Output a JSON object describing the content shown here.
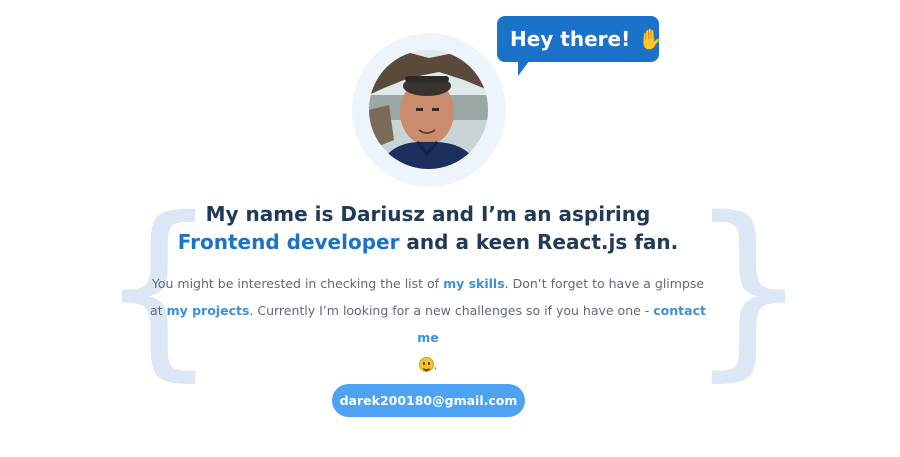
{
  "greeting": {
    "text": "Hey there!",
    "emoji_icon": "waving-hand-icon"
  },
  "profile": {
    "avatar_icon": "profile-photo"
  },
  "intro": {
    "line1": "My name is Dariusz and I’m an aspiring",
    "role": "Frontend developer",
    "line2_rest": " and a keen React.js fan."
  },
  "description": {
    "part1": "You might be interested in checking the list of ",
    "skills_link": "my skills",
    "part2": ". Don’t forget to have a glimpse at ",
    "projects_link": "my projects",
    "part3": ". Currently I’m looking for a new challenges so if you have one - ",
    "contact_link": "contact me",
    "part4": ".",
    "emoji_icon": "smiley-icon"
  },
  "email": {
    "label": "darek200180@gmail.com"
  },
  "decor": {
    "brace_left": "{",
    "brace_right": "}"
  },
  "colors": {
    "accent": "#1a73c9",
    "button": "#4da3f2",
    "heading": "#213a57",
    "brace": "#dbe7f4"
  }
}
